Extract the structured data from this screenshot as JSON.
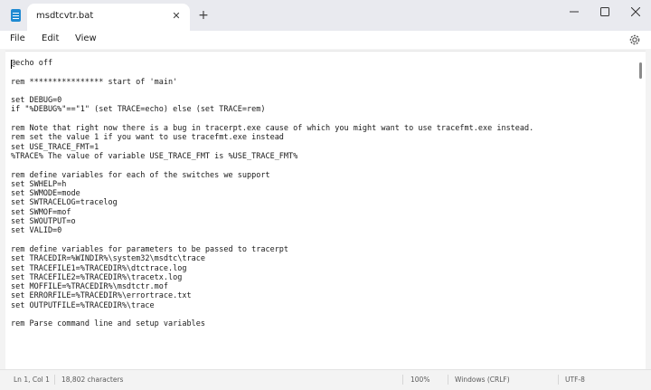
{
  "tab": {
    "title": "msdtcvtr.bat",
    "close_glyph": "✕",
    "new_tab_glyph": "+"
  },
  "menu": {
    "file": "File",
    "edit": "Edit",
    "view": "View"
  },
  "editor": {
    "lines": [
      "@echo off",
      "",
      "rem **************** start of 'main'",
      "",
      "set DEBUG=0",
      "if \"%DEBUG%\"==\"1\" (set TRACE=echo) else (set TRACE=rem)",
      "",
      "rem Note that right now there is a bug in tracerpt.exe cause of which you might want to use tracefmt.exe instead.",
      "rem set the value 1 if you want to use tracefmt.exe instead",
      "set USE_TRACE_FMT=1",
      "%TRACE% The value of variable USE_TRACE_FMT is %USE_TRACE_FMT%",
      "",
      "rem define variables for each of the switches we support",
      "set SWHELP=h",
      "set SWMODE=mode",
      "set SWTRACELOG=tracelog",
      "set SWMOF=mof",
      "set SWOUTPUT=o",
      "set VALID=0",
      "",
      "rem define variables for parameters to be passed to tracerpt",
      "set TRACEDIR=%WINDIR%\\system32\\msdtc\\trace",
      "set TRACEFILE1=%TRACEDIR%\\dtctrace.log",
      "set TRACEFILE2=%TRACEDIR%\\tracetx.log",
      "set MOFFILE=%TRACEDIR%\\msdtctr.mof",
      "set ERRORFILE=%TRACEDIR%\\errortrace.txt",
      "set OUTPUTFILE=%TRACEDIR%\\trace",
      "",
      "rem Parse command line and setup variables"
    ]
  },
  "status": {
    "position": "Ln 1, Col 1",
    "characters": "18,802 characters",
    "zoom": "100%",
    "line_ending": "Windows (CRLF)",
    "encoding": "UTF-8"
  },
  "icons": {
    "app": "notepad-icon",
    "settings": "gear-icon",
    "minimize": "minimize-icon",
    "maximize": "maximize-icon",
    "close": "close-icon"
  },
  "colors": {
    "accent": "#1f8ad2",
    "titlebar": "#e9eaef",
    "editor_bg": "#ffffff"
  }
}
